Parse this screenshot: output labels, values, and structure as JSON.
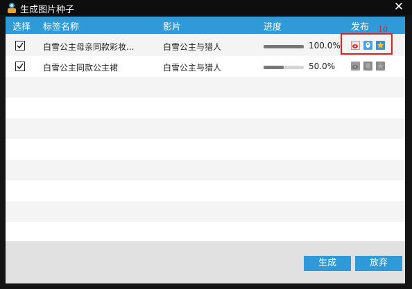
{
  "window": {
    "title": "生成图片种子",
    "close_glyph": "✕"
  },
  "table": {
    "columns": [
      "选择",
      "标签名称",
      "影片",
      "进度",
      "发布"
    ],
    "rows": [
      {
        "checked": true,
        "name": "白雪公主母亲同款彩妆...",
        "film": "白雪公主与猎人",
        "progress": 1.0,
        "progress_label": "100.0%",
        "publish_icons": [
          "sina-weibo-icon",
          "qq-icon",
          "qzone-star-icon"
        ],
        "publish_active": true
      },
      {
        "checked": true,
        "name": "白雪公主同款公主裙",
        "film": "白雪公主与猎人",
        "progress": 0.5,
        "progress_label": "50.0%",
        "publish_icons": [
          "sina-weibo-icon",
          "qq-icon",
          "qzone-star-icon"
        ],
        "publish_active": false
      }
    ]
  },
  "annotation": {
    "label": "10"
  },
  "buttons": {
    "generate": "生成",
    "cancel": "放弃"
  },
  "colors": {
    "header_blue": "#2f9ad7",
    "accent_red": "#e02020"
  }
}
